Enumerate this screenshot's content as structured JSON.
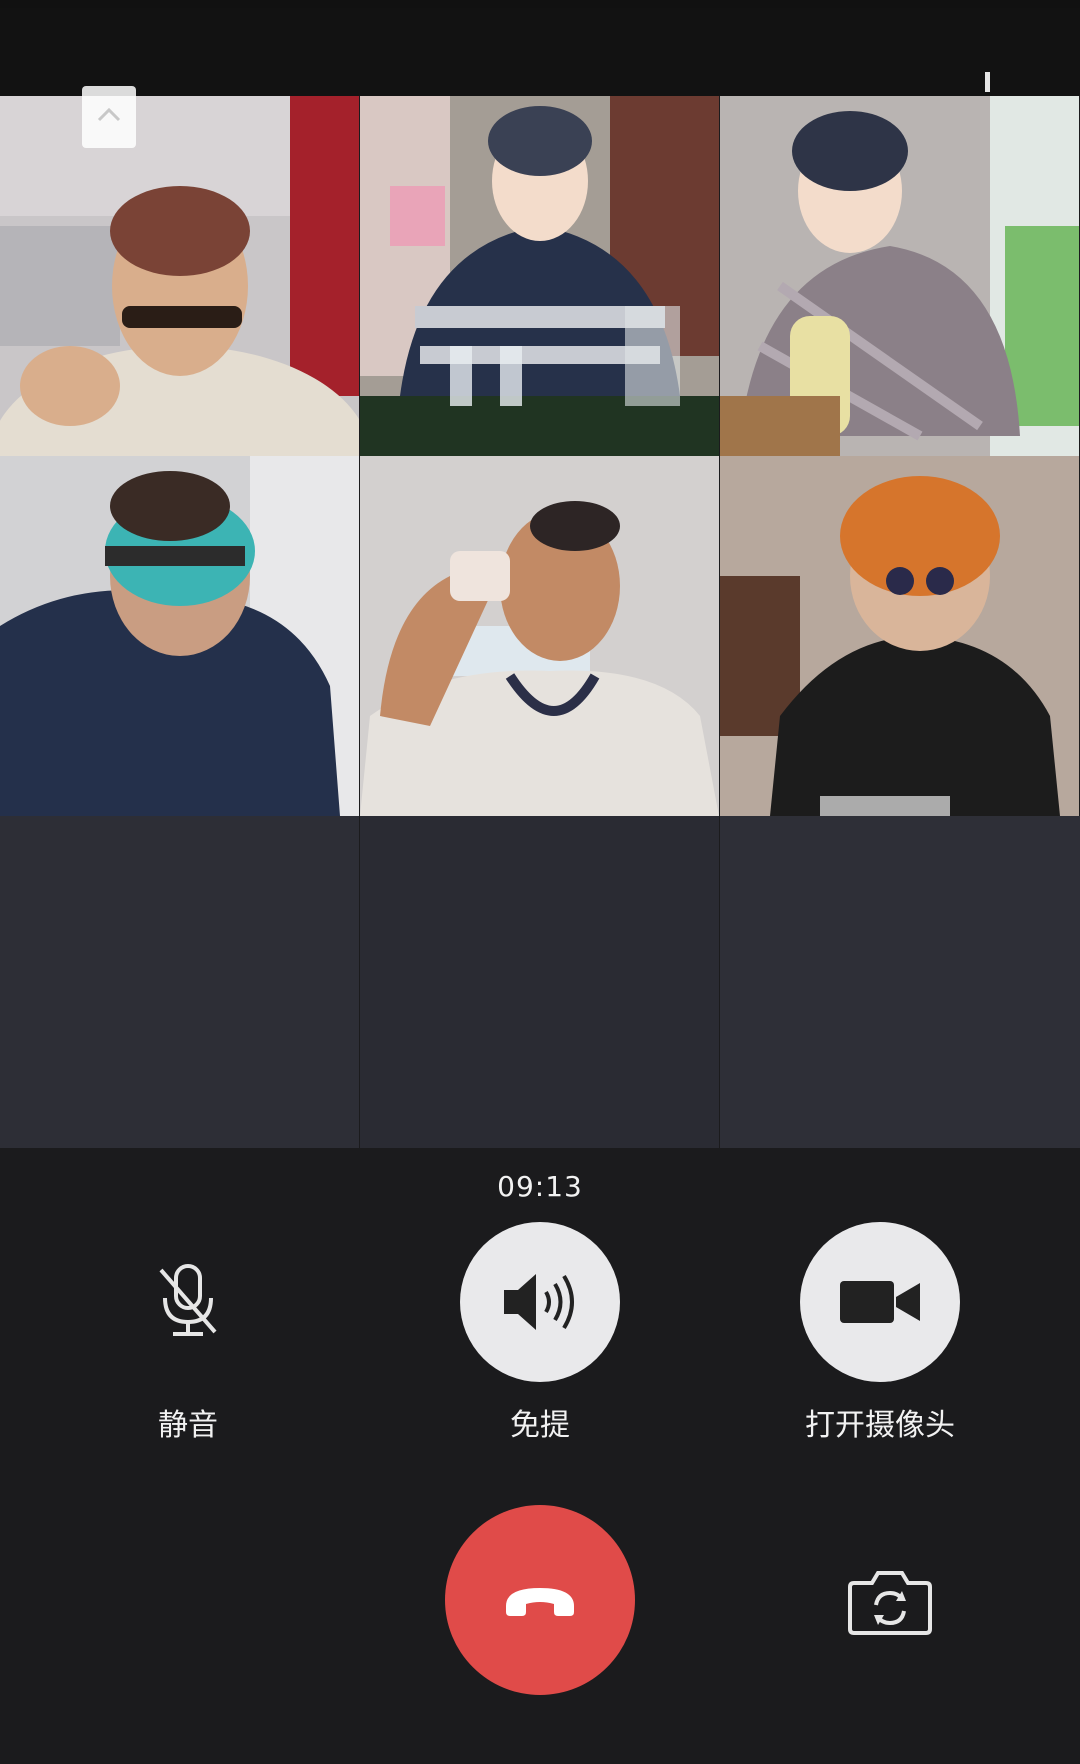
{
  "call": {
    "duration": "09:13"
  },
  "controls": {
    "mute_label": "静音",
    "speaker_label": "免提",
    "camera_label": "打开摄像头"
  },
  "icons": {
    "minimize": "chevron-up-icon",
    "mute": "microphone-off-icon",
    "speaker": "speaker-icon",
    "camera": "video-camera-icon",
    "hangup": "phone-hangup-icon",
    "flip": "switch-camera-icon"
  },
  "colors": {
    "background": "#1b1b1d",
    "empty_tile": "#2d2e36",
    "control_circle": "#e9e9eb",
    "hangup": "#e04b49"
  },
  "participants": [
    {
      "slot": 1,
      "video": true
    },
    {
      "slot": 2,
      "video": true
    },
    {
      "slot": 3,
      "video": true
    },
    {
      "slot": 4,
      "video": true
    },
    {
      "slot": 5,
      "video": true
    },
    {
      "slot": 6,
      "video": true
    },
    {
      "slot": 7,
      "video": false
    },
    {
      "slot": 8,
      "video": false
    },
    {
      "slot": 9,
      "video": false
    }
  ]
}
